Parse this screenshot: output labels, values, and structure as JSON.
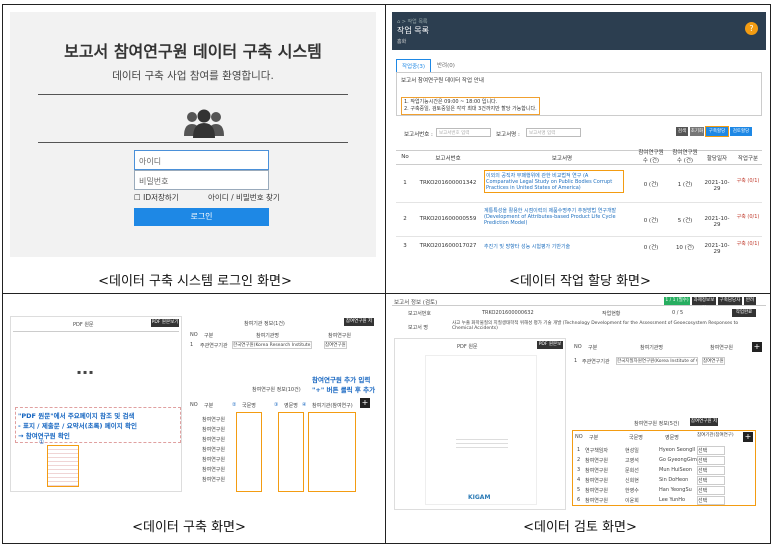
{
  "login": {
    "title": "보고서 참여연구원 데이터 구축 시스템",
    "subtitle": "데이터 구축 사업 참여를 환영합니다.",
    "id_placeholder": "아이디",
    "pw_placeholder": "비밀번호",
    "remember_label": "ID저장하기",
    "find_label": "아이디 / 비밀번호 찾기",
    "login_button": "로그인"
  },
  "assign": {
    "breadcrumb": "⌂ > 작업 목록",
    "title": "작업 목록",
    "crumb2": "홈화",
    "help": "?",
    "tab_active": "작업중(3)",
    "tab_other": "반려(0)",
    "box_title": "보고서 참여연구원 데이터 작업 안내",
    "note1": "1. 작업기능시간은 09:00 ~ 18:00 입니다.",
    "note2": "2. 구축중일, 검토중일은 각각 최대 3건까지만 할당 가능합니다.",
    "search_label1": "보고서번호 :",
    "search_ph1": "보고서번호 입력",
    "search_label2": "보고서명 :",
    "search_ph2": "보고서명 입력",
    "btn1": "검색",
    "btn2": "초기화",
    "btn3": "구축할당",
    "btn4": "검토할당",
    "headers": [
      "No",
      "보고서번호",
      "보고서명",
      "참여연구원수 (건)",
      "참여연구원수 (건)",
      "할당일자",
      "작업구분"
    ],
    "rows": [
      {
        "no": "1",
        "id": "TRKO201600001342",
        "name": "이외의 공직자 부패행위에 관한 비교법적 연구 (A Comparative Legal Study on Public Bodies Corrupt Practices in United States of America)",
        "c1": "0 (건)",
        "c2": "1 (건)",
        "date": "2021-10-29",
        "type": "구축 (0/1)"
      },
      {
        "no": "2",
        "id": "TRKO201600000559",
        "name": "계통특성을 활용한 시점이력의 제품수명주기 추정방법 연구개발 (Development of Attributes-based Product Life Cycle Prediction Model)",
        "c1": "0 (건)",
        "c2": "5 (건)",
        "date": "2021-10-29",
        "type": "구축 (0/1)"
      },
      {
        "no": "3",
        "id": "TRKO201600017027",
        "name": "추진기 및 방향타 성능 시험평가 기반기술",
        "c1": "0 (건)",
        "c2": "10 (건)",
        "date": "2021-10-29",
        "type": "구축 (0/1)"
      }
    ]
  },
  "build": {
    "pdf_label": "PDF 원문",
    "pdf_btn": "PDF 원본보기",
    "info_title": "참여기관 정보(1건)",
    "info_btn": "참여연구원 저장",
    "t1_headers": [
      "NO",
      "구분",
      "참여기관명",
      "참여연구원"
    ],
    "t1_row": [
      "1",
      "주관연구기관",
      "한국연구원(Korea Research Institute)",
      "참여연구원"
    ],
    "researcher_title": "참여연구원 정보(10건)",
    "annotation_title": "참여연구원 추가 입력",
    "annotation_sub": "\"+\" 버튼 클릭 후 추가",
    "t2_headers": [
      "NO",
      "구분",
      "국문명",
      "영문명",
      "참여기관(참여연구)"
    ],
    "left_note1": "\"PDF 원문\"에서 주요페이지 참조 및 검색",
    "left_note2": "- 표지 / 제출문 / 요약서(초록) 페이지 확인",
    "left_note3": "→ 참여연구원 확인",
    "circled": [
      "①",
      "②",
      "③",
      "④"
    ],
    "row_label": "참여연구원",
    "dots": "▪ ▪ ▪"
  },
  "review": {
    "header": "보고서 정보 (검토)",
    "badge1": "1 / 1 (필수)",
    "badge2": "과제정보보기",
    "badge3": "구축담당자",
    "badge4": "반려",
    "row1_label": "보고서번호",
    "row1_value": "TRKO201600000632",
    "row1_label2": "작업현황",
    "row1_value2": "0 / 5",
    "row1_btn": "작업완료",
    "row2_label": "보고서 명",
    "row2_value": "사고 누출 화학물질의 지질생태학적 위해성 평가 기술 개발 (Technology Development for the Assessment of Geoecosystem Responses to Chemical Accidents)",
    "pdf_label": "PDF 원문",
    "pdf_btn": "PDF 원본보기",
    "t1_headers": [
      "NO",
      "구분",
      "참여기관명",
      "참여연구원"
    ],
    "t1_row": [
      "1",
      "주관연구기관",
      "한국지질자원연구원(Korea Institute of Geoscience...)",
      "참여연구원"
    ],
    "researcher_title": "참여연구원 정보(5건)",
    "researcher_btn": "참여연구원 저장",
    "t2_headers": [
      "NO",
      "구분",
      "국문명",
      "영문명",
      "참여기관(참여연구)"
    ],
    "t2_rows": [
      [
        "1",
        "연구책임자",
        "현성일",
        "Hyeon SeongIl",
        "선택"
      ],
      [
        "2",
        "참여연구원",
        "고영석",
        "Go GyeongGim",
        "선택"
      ],
      [
        "3",
        "참여연구원",
        "문희선",
        "Mun HuiSeon",
        "선택"
      ],
      [
        "4",
        "참여연구원",
        "신희현",
        "Sin DoHeon",
        "선택"
      ],
      [
        "5",
        "참여연구원",
        "한영수",
        "Han YeongSu",
        "선택"
      ],
      [
        "6",
        "참여연구원",
        "이윤희",
        "Lee YunHo",
        "선택"
      ]
    ],
    "kigam": "KIGAM"
  },
  "captions": {
    "c1": "<데이터 구축 시스템 로그인 화면>",
    "c2": "<데이터 작업 할당 화면>",
    "c3": "<데이터 구축 화면>",
    "c4": "<데이터 검토 화면>"
  },
  "colors": {
    "accent": "#1e88e5",
    "highlight": "#f39c12",
    "dark": "#2c3e50"
  }
}
